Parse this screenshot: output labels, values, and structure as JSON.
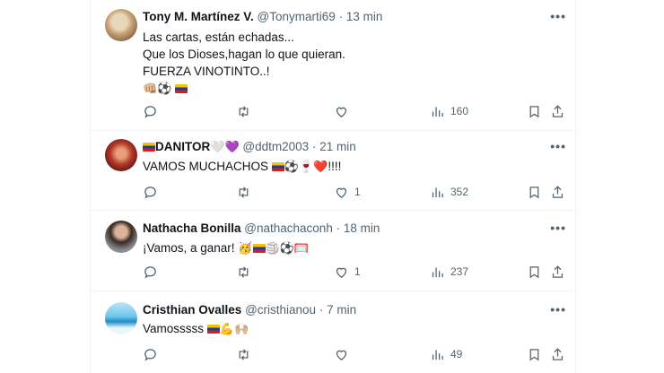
{
  "tweets": [
    {
      "name": "Tony M. Martínez V.",
      "handle": "@Tonymarti69",
      "sep": "·",
      "time": "13 min",
      "lines": [
        "Las cartas, están echadas...",
        "Que los Dioses,hagan lo que quieran.",
        "FUERZA VINOTINTO..!"
      ],
      "emoji": "👊🏼⚽",
      "reply_count": "",
      "like_count": "",
      "views": "160"
    },
    {
      "name_prefix_emoji": "",
      "name": "DANITOR",
      "name_suffix_emoji": "🤍💜",
      "handle": "@ddtm2003",
      "sep": "·",
      "time": "21 min",
      "text": "VAMOS MUCHACHOS",
      "emoji": "⚽🍷❤️",
      "text_suffix": "!!!!",
      "reply_count": "",
      "like_count": "1",
      "views": "352"
    },
    {
      "name": "Nathacha Bonilla",
      "handle": "@nathachaconh",
      "sep": "·",
      "time": "18 min",
      "text": "¡Vamos, a ganar!",
      "emoji_a": "🥳",
      "emoji_b": "🏐⚽🥅",
      "reply_count": "",
      "like_count": "1",
      "views": "237"
    },
    {
      "name": "Cristhian Ovalles",
      "handle": "@cristhianou",
      "sep": "·",
      "time": "7 min",
      "text": "Vamosssss",
      "emoji": "💪🙌🏼",
      "reply_count": "",
      "like_count": "",
      "views": "49"
    }
  ],
  "more_label": "•••",
  "colors": {
    "text": "#0f1419",
    "muted": "#536471",
    "divider": "#eff3f4"
  },
  "icons": [
    "reply-icon",
    "retweet-icon",
    "like-icon",
    "views-icon",
    "bookmark-icon",
    "share-icon"
  ]
}
